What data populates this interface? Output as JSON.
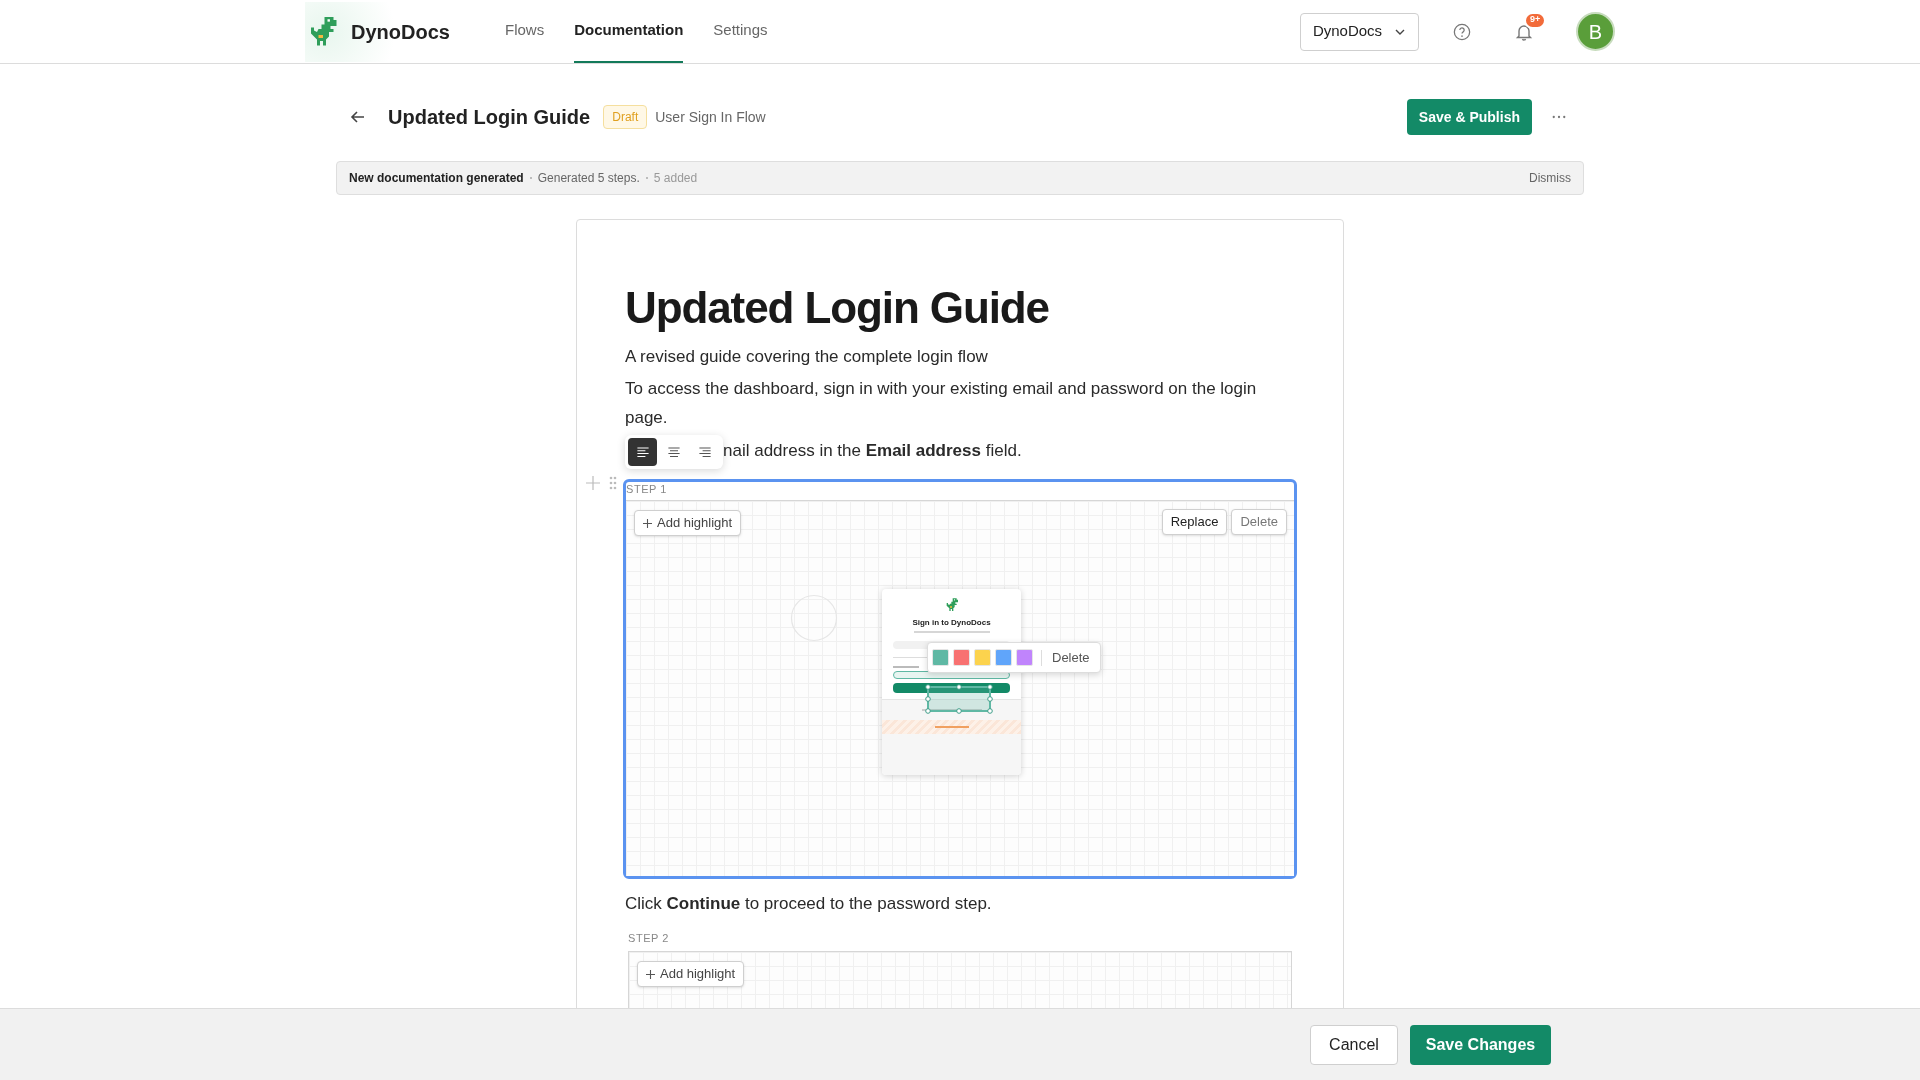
{
  "header": {
    "brand": "DynoDocs",
    "nav": [
      {
        "label": "Flows",
        "selected": false
      },
      {
        "label": "Documentation",
        "selected": true
      },
      {
        "label": "Settings",
        "selected": false
      }
    ],
    "workspace": "DynoDocs",
    "notification_badge": "9+",
    "avatar": "B"
  },
  "toolbar": {
    "title": "Updated Login Guide",
    "status": "Draft",
    "flow": "User Sign In Flow",
    "publish": "Save & Publish"
  },
  "banner": {
    "title": "New documentation generated",
    "details": [
      "Generated 5 steps.",
      "5 added"
    ],
    "dismiss": "Dismiss"
  },
  "document": {
    "title": "Updated Login Guide",
    "blocks": [
      {
        "kind": "paragraph",
        "text": "A revised guide covering the complete login flow"
      },
      {
        "kind": "paragraph",
        "text": "To access the dashboard, sign in with your existing email and password on the login page."
      },
      {
        "kind": "paragraph",
        "text": "nail address in the **Email address** field.",
        "align_menu": [
          {
            "kind": "left",
            "selected": true
          },
          {
            "kind": "center",
            "selected": false
          },
          {
            "kind": "right",
            "selected": false
          }
        ]
      },
      {
        "kind": "step",
        "label": "STEP 1",
        "selected": true,
        "add_highlight": "Add highlight",
        "actions": [
          "Replace",
          "Delete"
        ],
        "screenshot": {
          "title": "Sign in to DynoDocs"
        },
        "highlight_menu": {
          "colors": [
            {
              "color": "#5fb8a4",
              "selected": false
            },
            {
              "color": "#f87171",
              "selected": false
            },
            {
              "color": "#fcd34d",
              "selected": false
            },
            {
              "color": "#60a5fa",
              "selected": false
            },
            {
              "color": "#c084fc",
              "selected": false
            }
          ],
          "delete": "Delete"
        }
      },
      {
        "kind": "paragraph",
        "text": "Click **Continue** to proceed to the password step."
      },
      {
        "kind": "step",
        "label": "STEP 2",
        "selected": false,
        "add_highlight": "Add highlight"
      }
    ]
  },
  "footer": {
    "cancel": "Cancel",
    "save": "Save Changes"
  }
}
